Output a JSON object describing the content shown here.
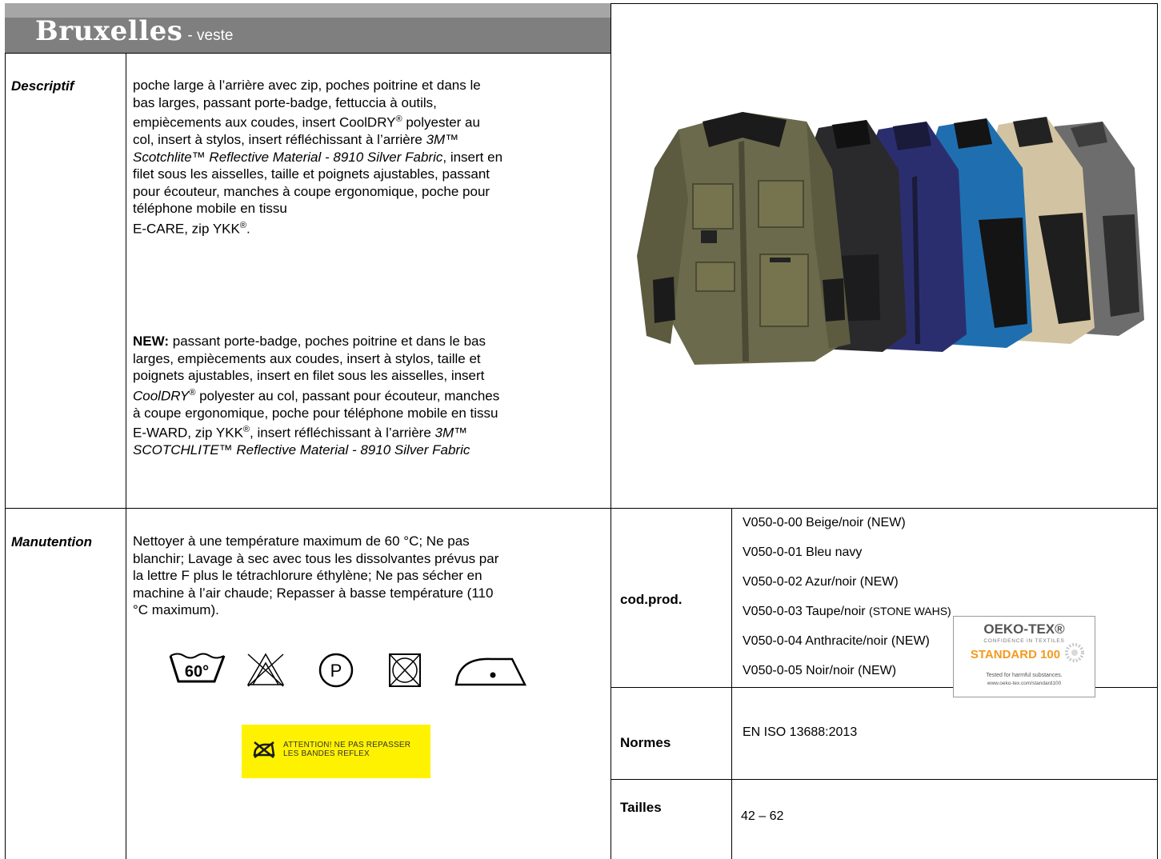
{
  "header": {
    "title": "Bruxelles",
    "subtitle": "-  veste"
  },
  "descriptif": {
    "label": "Descriptif",
    "paragraph1": [
      "poche large à l’arrière avec zip, poches poitrine et dans le",
      "bas larges, passant porte-badge, fettuccia à outils,",
      "empiècements aux coudes, insert CoolDRY",
      "®",
      " polyester au",
      "col, insert à stylos, insert réfléchissant à l’arrière ",
      "3M™",
      "Scotchlite™ Reflective Material - 8910 Silver Fabric",
      ", insert en",
      "filet sous les aisselles, taille et poignets ajustables, passant",
      "pour écouteur, manches à coupe ergonomique, poche pour",
      "téléphone mobile en tissu",
      "E-CARE, zip YKK",
      "®",
      "."
    ],
    "new_label": "NEW:",
    "paragraph2": [
      " passant porte-badge, poches poitrine et dans le bas",
      "larges, empiècements aux coudes, insert à stylos, taille et",
      "poignets ajustables, insert en filet sous les aisselles, insert",
      "CoolDRY",
      "®",
      " polyester au col, passant pour écouteur, manches",
      "à coupe ergonomique, poche pour téléphone mobile en tissu",
      "E-WARD, zip YKK",
      "®",
      ", insert réfléchissant à l’arrière ",
      "3M™",
      "SCOTCHLITE™ Reflective Material - 8910 Silver Fabric"
    ]
  },
  "manutention": {
    "label": "Manutention",
    "text": [
      "Nettoyer à une température maximum de 60 °C; Ne pas",
      "blanchir; Lavage à sec avec tous les dissolvantes prévus par",
      "la lettre F plus le tétrachlorure éthylène; Ne pas sécher en",
      "machine à l’air chaude; Repasser à basse température (110",
      "°C maximum)."
    ],
    "care_icons": [
      "wash-60-icon",
      "no-bleach-icon",
      "dry-clean-p-icon",
      "no-tumble-dry-icon",
      "iron-low-icon"
    ],
    "wash_temp": "60°",
    "dry_clean_letter": "P",
    "reflex_warning": [
      "ATTENTION! NE PAS REPASSER",
      "LES BANDES REFLEX"
    ]
  },
  "codprod": {
    "label": "cod.prod.",
    "items": [
      {
        "code": "V050-0-00 Beige/noir (NEW)",
        "note": ""
      },
      {
        "code": "V050-0-01 Bleu navy",
        "note": ""
      },
      {
        "code": "V050-0-02 Azur/noir (NEW)",
        "note": ""
      },
      {
        "code": "V050-0-03 Taupe/noir ",
        "note": "(STONE WAHS)"
      },
      {
        "code": "V050-0-04 Anthracite/noir (NEW)",
        "note": ""
      },
      {
        "code": "V050-0-05 Noir/noir (NEW)",
        "note": ""
      }
    ]
  },
  "normes": {
    "label": "Normes",
    "value": "EN ISO 13688:2013",
    "oeko": {
      "title": "OEKO-TEX®",
      "confidence": "CONFIDENCE IN TEXTILES",
      "standard": "STANDARD 100",
      "tested": "Tested for harmful substances.",
      "url": "www.oeko-tex.com/standard100"
    }
  },
  "tailles": {
    "label": "Tailles",
    "value": "42 – 62"
  },
  "colors": {
    "header_dark": "#7f7f7f",
    "header_light": "#a6a6a6",
    "warning_yellow": "#fff200",
    "oeko_orange": "#f39a1e",
    "jacket_colors": [
      "#6b6a4c",
      "#2a2a2c",
      "#2b2e6e",
      "#1f6fb0",
      "#d2c4a2",
      "#6d6d6d"
    ]
  }
}
